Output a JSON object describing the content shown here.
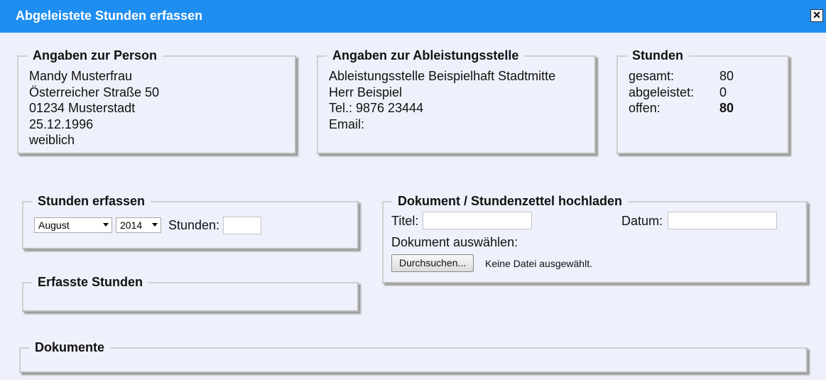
{
  "dialog": {
    "title": "Abgeleistete Stunden erfassen",
    "close_label": "✕"
  },
  "person": {
    "legend": "Angaben zur Person",
    "name": "Mandy Musterfrau",
    "street": "Österreicher Straße 50",
    "city": "01234 Musterstadt",
    "birthdate": "25.12.1996",
    "gender": "weiblich"
  },
  "location": {
    "legend": "Angaben zur Ableistungsstelle",
    "name": "Ableistungsstelle Beispielhaft Stadtmitte",
    "contact": "Herr Beispiel",
    "phone": "Tel.: 9876 23444",
    "email": "Email:"
  },
  "hours": {
    "legend": "Stunden",
    "total_label": "gesamt:",
    "total_value": "80",
    "done_label": "abgeleistet:",
    "done_value": "0",
    "open_label": "offen:",
    "open_value": "80"
  },
  "entry": {
    "legend": "Stunden erfassen",
    "month_value": "August",
    "year_value": "2014",
    "hours_label": "Stunden:",
    "hours_value": ""
  },
  "upload": {
    "legend": "Dokument / Stundenzettel hochladen",
    "title_label": "Titel:",
    "title_value": "",
    "date_label": "Datum:",
    "date_value": "",
    "choose_label": "Dokument auswählen:",
    "browse_button": "Durchsuchen...",
    "file_status": "Keine Datei ausgewählt."
  },
  "recorded": {
    "legend": "Erfasste Stunden"
  },
  "documents": {
    "legend": "Dokumente"
  }
}
